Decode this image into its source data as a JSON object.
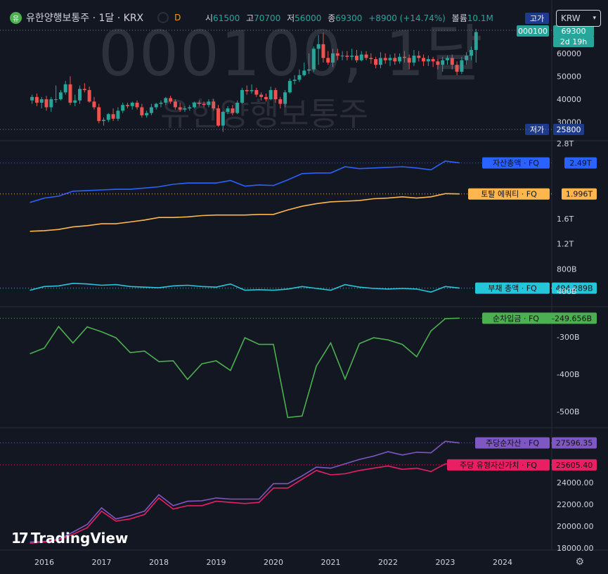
{
  "header": {
    "logo_glyph": "유",
    "title": "유한양행보통주 · 1달 · KRX",
    "interval_badge": "D",
    "open_label": "시",
    "open": "61500",
    "high_label": "고",
    "high": "70700",
    "low_label": "저",
    "low": "56000",
    "close_label": "종",
    "close": "69300",
    "change": "+8900 (+14.74%)",
    "volume_label": "볼륨",
    "volume": "10.1M",
    "currency": "KRW"
  },
  "watermark": {
    "symbol": "000100, 1달",
    "name": "유한양행보통주"
  },
  "price_pane": {
    "high_tag_label": "고가",
    "symbol_tag": "000100",
    "price_tag": "69300",
    "countdown_tag": "2d 19h",
    "low_tag_label": "저가",
    "low_tag_value": "25800",
    "axis_ticks": [
      "60000",
      "50000",
      "40000",
      "30000"
    ],
    "axis_values": [
      60000,
      50000,
      40000,
      30000
    ],
    "range": [
      25000,
      71000
    ]
  },
  "x_axis": {
    "labels": [
      "2016",
      "2017",
      "2018",
      "2019",
      "2020",
      "2021",
      "2022",
      "2023",
      "2024"
    ],
    "years": [
      2016,
      2017,
      2018,
      2019,
      2020,
      2021,
      2022,
      2023,
      2024
    ]
  },
  "colors": {
    "background": "#131722",
    "up": "#26a69a",
    "down": "#ef5350",
    "total_assets": "#2962ff",
    "total_equity": "#ffb74d",
    "total_liabilities": "#26c6da",
    "net_debt": "#4caf50",
    "bvps": "#7e57c2",
    "tbvps": "#e91e63"
  },
  "chart_data": [
    {
      "type": "candlestick",
      "title": "유한양행보통주 · 1달 · KRX",
      "interval": "1M",
      "x": [
        "2015-10",
        "2015-11",
        "2015-12",
        "2016-01",
        "2016-02",
        "2016-03",
        "2016-04",
        "2016-05",
        "2016-06",
        "2016-07",
        "2016-08",
        "2016-09",
        "2016-10",
        "2016-11",
        "2016-12",
        "2017-01",
        "2017-02",
        "2017-03",
        "2017-04",
        "2017-05",
        "2017-06",
        "2017-07",
        "2017-08",
        "2017-09",
        "2017-10",
        "2017-11",
        "2017-12",
        "2018-01",
        "2018-02",
        "2018-03",
        "2018-04",
        "2018-05",
        "2018-06",
        "2018-07",
        "2018-08",
        "2018-09",
        "2018-10",
        "2018-11",
        "2018-12",
        "2019-01",
        "2019-02",
        "2019-03",
        "2019-04",
        "2019-05",
        "2019-06",
        "2019-07",
        "2019-08",
        "2019-09",
        "2019-10",
        "2019-11",
        "2019-12",
        "2020-01",
        "2020-02",
        "2020-03",
        "2020-04",
        "2020-05",
        "2020-06",
        "2020-07",
        "2020-08",
        "2020-09",
        "2020-10",
        "2020-11",
        "2020-12",
        "2021-01",
        "2021-02",
        "2021-03",
        "2021-04",
        "2021-05",
        "2021-06",
        "2021-07",
        "2021-08",
        "2021-09",
        "2021-10",
        "2021-11",
        "2021-12",
        "2022-01",
        "2022-02",
        "2022-03",
        "2022-04",
        "2022-05",
        "2022-06",
        "2022-07",
        "2022-08",
        "2022-09",
        "2022-10",
        "2022-11",
        "2022-12",
        "2023-01",
        "2023-02",
        "2023-03",
        "2023-04",
        "2023-05",
        "2023-06",
        "2023-07"
      ],
      "open": [
        39500,
        41000,
        38500,
        40000,
        36500,
        40000,
        40000,
        43000,
        46500,
        38500,
        39500,
        44500,
        44000,
        39000,
        36500,
        30500,
        31000,
        33500,
        31500,
        35000,
        37500,
        37000,
        38500,
        36500,
        33000,
        34000,
        36500,
        38000,
        38500,
        40500,
        39000,
        36500,
        35500,
        36000,
        36500,
        38500,
        38000,
        37500,
        39000,
        36000,
        28500,
        34500,
        36000,
        34000,
        38500,
        44000,
        43500,
        44000,
        42000,
        41000,
        40000,
        44000,
        40000,
        38000,
        43000,
        48000,
        48500,
        50500,
        52500,
        53000,
        62000,
        64000,
        58000,
        56000,
        60000,
        59000,
        59000,
        58500,
        59000,
        57000,
        59500,
        58000,
        57500,
        55000,
        58000,
        57000,
        58000,
        56500,
        58500,
        58000,
        56000,
        59000,
        58000,
        56500,
        57500,
        56500,
        55000,
        57000,
        58000,
        55000,
        52000,
        57000,
        59000,
        61500
      ],
      "high": [
        42000,
        42500,
        41000,
        41500,
        41000,
        46000,
        44000,
        48000,
        50000,
        42000,
        46000,
        47000,
        45500,
        41000,
        38000,
        32000,
        34000,
        36000,
        36500,
        38500,
        38500,
        39000,
        39500,
        38000,
        35000,
        38000,
        38500,
        39500,
        41000,
        41500,
        40000,
        38500,
        37000,
        37500,
        39000,
        39500,
        39000,
        40000,
        40000,
        37500,
        35000,
        37000,
        37500,
        39500,
        45000,
        46000,
        46500,
        45000,
        43000,
        42500,
        45500,
        45000,
        41000,
        44000,
        49000,
        50500,
        53000,
        56000,
        60000,
        63000,
        68000,
        69000,
        61000,
        62000,
        62000,
        61000,
        61000,
        62000,
        61500,
        61000,
        61000,
        60000,
        58500,
        60500,
        60000,
        59500,
        60000,
        60000,
        61000,
        59500,
        61500,
        61000,
        59500,
        59000,
        58500,
        57500,
        58500,
        59000,
        59500,
        56500,
        58500,
        60500,
        63000,
        70700
      ],
      "low": [
        38000,
        37000,
        36000,
        35000,
        34500,
        38500,
        39500,
        42000,
        37500,
        37000,
        38000,
        43000,
        38500,
        35500,
        29500,
        28500,
        30000,
        30500,
        30500,
        34000,
        36000,
        35500,
        35500,
        32000,
        32000,
        33000,
        35500,
        36500,
        37500,
        38000,
        35500,
        34500,
        34500,
        35000,
        36000,
        37000,
        36500,
        36500,
        35000,
        28000,
        25800,
        33500,
        33000,
        33500,
        38000,
        42000,
        42500,
        41000,
        39500,
        39000,
        39500,
        38500,
        36000,
        36500,
        42500,
        46500,
        47500,
        50000,
        51000,
        52000,
        55000,
        56000,
        55000,
        54000,
        57000,
        57000,
        57000,
        57000,
        56000,
        56500,
        57000,
        55500,
        53500,
        53500,
        55500,
        54500,
        55000,
        55500,
        56000,
        53000,
        54500,
        56500,
        54500,
        54500,
        54000,
        53000,
        52000,
        55000,
        53000,
        50500,
        51000,
        55000,
        57000,
        56000
      ],
      "close": [
        41000,
        38500,
        40000,
        36500,
        40000,
        40000,
        43000,
        46500,
        38500,
        39500,
        44500,
        44000,
        39000,
        36500,
        30500,
        31000,
        33500,
        31500,
        35000,
        37500,
        37000,
        38500,
        36500,
        33000,
        34000,
        36500,
        38000,
        38500,
        40500,
        39000,
        36500,
        35500,
        36000,
        36500,
        38500,
        38000,
        37500,
        39000,
        36000,
        28500,
        34500,
        36000,
        34000,
        38500,
        44000,
        43500,
        44000,
        42000,
        41000,
        40000,
        44000,
        40000,
        38000,
        43000,
        48000,
        48500,
        50500,
        52500,
        53000,
        62000,
        64000,
        58000,
        56000,
        60000,
        59000,
        59000,
        58500,
        59000,
        57000,
        59500,
        58000,
        57500,
        55000,
        58000,
        57000,
        58000,
        56500,
        58500,
        58000,
        56000,
        59000,
        58000,
        56500,
        57500,
        56500,
        55000,
        57000,
        58000,
        55000,
        52000,
        57000,
        59000,
        61500,
        69300
      ]
    },
    {
      "type": "line",
      "x": [
        2015.75,
        2016.0,
        2016.25,
        2016.5,
        2016.75,
        2017.0,
        2017.25,
        2017.5,
        2017.75,
        2018.0,
        2018.25,
        2018.5,
        2018.75,
        2019.0,
        2019.25,
        2019.5,
        2019.75,
        2020.0,
        2020.25,
        2020.5,
        2020.75,
        2021.0,
        2021.25,
        2021.5,
        2021.75,
        2022.0,
        2022.25,
        2022.5,
        2022.75,
        2023.0,
        2023.25
      ],
      "series": [
        {
          "name": "자산총액 · FQ",
          "last_value": "2.49T",
          "values": [
            1.86,
            1.93,
            1.96,
            2.04,
            2.05,
            2.06,
            2.07,
            2.07,
            2.09,
            2.11,
            2.15,
            2.17,
            2.17,
            2.17,
            2.21,
            2.12,
            2.14,
            2.13,
            2.22,
            2.32,
            2.33,
            2.33,
            2.43,
            2.4,
            2.41,
            2.42,
            2.43,
            2.41,
            2.38,
            2.52,
            2.49
          ]
        },
        {
          "name": "토탈 에쿼티 · FQ",
          "last_value": "1.996T",
          "values": [
            1.4,
            1.41,
            1.43,
            1.47,
            1.49,
            1.52,
            1.52,
            1.55,
            1.58,
            1.62,
            1.62,
            1.63,
            1.65,
            1.66,
            1.66,
            1.66,
            1.67,
            1.67,
            1.74,
            1.8,
            1.84,
            1.87,
            1.88,
            1.89,
            1.92,
            1.93,
            1.95,
            1.93,
            1.95,
            2.0,
            1.996
          ]
        },
        {
          "name": "부채 총액 · FQ",
          "last_value": "494.289B",
          "values": [
            0.46,
            0.52,
            0.53,
            0.57,
            0.56,
            0.54,
            0.55,
            0.52,
            0.51,
            0.5,
            0.53,
            0.54,
            0.52,
            0.51,
            0.56,
            0.46,
            0.47,
            0.46,
            0.48,
            0.52,
            0.49,
            0.46,
            0.55,
            0.51,
            0.49,
            0.48,
            0.49,
            0.48,
            0.43,
            0.52,
            0.494
          ]
        }
      ],
      "axis_ticks": [
        "2.8T",
        "1.6T",
        "1.2T",
        "800B",
        "400B"
      ]
    },
    {
      "type": "line",
      "x": [
        2015.75,
        2016.0,
        2016.25,
        2016.5,
        2016.75,
        2017.0,
        2017.25,
        2017.5,
        2017.75,
        2018.0,
        2018.25,
        2018.5,
        2018.75,
        2019.0,
        2019.25,
        2019.5,
        2019.75,
        2020.0,
        2020.25,
        2020.5,
        2020.75,
        2021.0,
        2021.25,
        2021.5,
        2021.75,
        2022.0,
        2022.25,
        2022.5,
        2022.75,
        2023.0,
        2023.25
      ],
      "series": [
        {
          "name": "순차입금 · FQ",
          "last_value": "-249.656B",
          "values": [
            -345,
            -330,
            -272,
            -316,
            -273,
            -286,
            -302,
            -342,
            -338,
            -366,
            -364,
            -414,
            -372,
            -364,
            -390,
            -302,
            -320,
            -320,
            -516,
            -512,
            -378,
            -316,
            -413,
            -318,
            -302,
            -308,
            -320,
            -353,
            -284,
            -251,
            -249.656
          ]
        }
      ],
      "axis_ticks": [
        "-300B",
        "-400B",
        "-500B"
      ]
    },
    {
      "type": "line",
      "x": [
        2015.75,
        2016.0,
        2016.25,
        2016.5,
        2016.75,
        2017.0,
        2017.25,
        2017.5,
        2017.75,
        2018.0,
        2018.25,
        2018.5,
        2018.75,
        2019.0,
        2019.25,
        2019.5,
        2019.75,
        2020.0,
        2020.25,
        2020.5,
        2020.75,
        2021.0,
        2021.25,
        2021.5,
        2021.75,
        2022.0,
        2022.25,
        2022.5,
        2022.75,
        2023.0,
        2023.25
      ],
      "series": [
        {
          "name": "주당순자산 · FQ",
          "last_value": "27596.35",
          "values": [
            18600,
            18650,
            18850,
            19500,
            20200,
            21700,
            20700,
            21000,
            21400,
            22900,
            21900,
            22300,
            22350,
            22600,
            22500,
            22500,
            22500,
            23900,
            23900,
            24600,
            25400,
            25300,
            25700,
            26100,
            26400,
            26800,
            26500,
            26750,
            26700,
            27750,
            27596.35
          ]
        },
        {
          "name": "주당 유형자산가치 · FQ",
          "last_value": "25605.40",
          "values": [
            18500,
            18600,
            18800,
            19300,
            19900,
            21400,
            20500,
            20700,
            21100,
            22600,
            21600,
            21900,
            21900,
            22300,
            22200,
            22100,
            22200,
            23500,
            23500,
            24300,
            25100,
            24700,
            24800,
            25100,
            25300,
            25500,
            25200,
            25300,
            25000,
            25700,
            25605.4
          ]
        }
      ],
      "axis_ticks": [
        "24000.00",
        "22000.00",
        "20000.00",
        "18000.00"
      ]
    }
  ],
  "branding": {
    "name": "TradingView"
  }
}
